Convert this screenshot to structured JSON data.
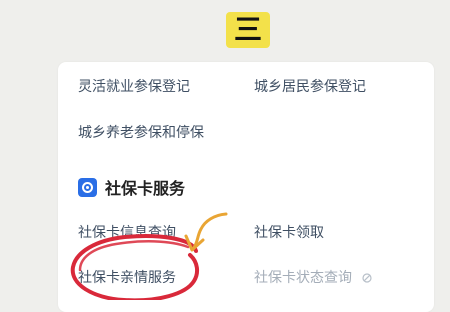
{
  "step_badge": {
    "text": "三",
    "color": "#f3e14a"
  },
  "rows": {
    "flexible_employment": "灵活就业参保登记",
    "urban_rural_resident": "城乡居民参保登记",
    "urban_rural_pension": "城乡养老参保和停保"
  },
  "section": {
    "title": "社保卡服务",
    "icon": "social-security-card-icon",
    "accent": "#2a6ee6"
  },
  "services": {
    "card_info_query": "社保卡信息查询",
    "card_claim": "社保卡领取",
    "card_family_service": "社保卡亲情服务",
    "card_status_query": "社保卡状态查询"
  },
  "annotation_colors": {
    "circle": "#d9293a",
    "arrow": "#e9a534"
  }
}
